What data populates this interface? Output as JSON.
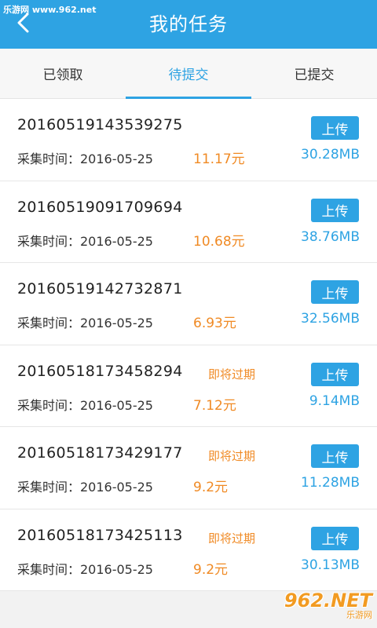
{
  "watermark": {
    "site": "乐游网 www.962.net",
    "logo": "962.NET",
    "logo_sub": "乐游网"
  },
  "header": {
    "title": "我的任务",
    "back_icon": "chevron-left-icon"
  },
  "tabs": [
    {
      "label": "已领取",
      "active": false
    },
    {
      "label": "待提交",
      "active": true
    },
    {
      "label": "已提交",
      "active": false
    }
  ],
  "tasks": [
    {
      "id": "20160519143539275",
      "expire": "",
      "date_label": "采集时间：2016-05-25",
      "price": "11.17元",
      "upload": "上传",
      "size": "30.28MB"
    },
    {
      "id": "20160519091709694",
      "expire": "",
      "date_label": "采集时间：2016-05-25",
      "price": "10.68元",
      "upload": "上传",
      "size": "38.76MB"
    },
    {
      "id": "20160519142732871",
      "expire": "",
      "date_label": "采集时间：2016-05-25",
      "price": "6.93元",
      "upload": "上传",
      "size": "32.56MB"
    },
    {
      "id": "20160518173458294",
      "expire": "即将过期",
      "date_label": "采集时间：2016-05-25",
      "price": "7.12元",
      "upload": "上传",
      "size": "9.14MB"
    },
    {
      "id": "20160518173429177",
      "expire": "即将过期",
      "date_label": "采集时间：2016-05-25",
      "price": "9.2元",
      "upload": "上传",
      "size": "11.28MB"
    },
    {
      "id": "20160518173425113",
      "expire": "即将过期",
      "date_label": "采集时间：2016-05-25",
      "price": "9.2元",
      "upload": "上传",
      "size": "30.13MB"
    }
  ],
  "colors": {
    "accent": "#2ea3e3",
    "price": "#f08a24"
  }
}
